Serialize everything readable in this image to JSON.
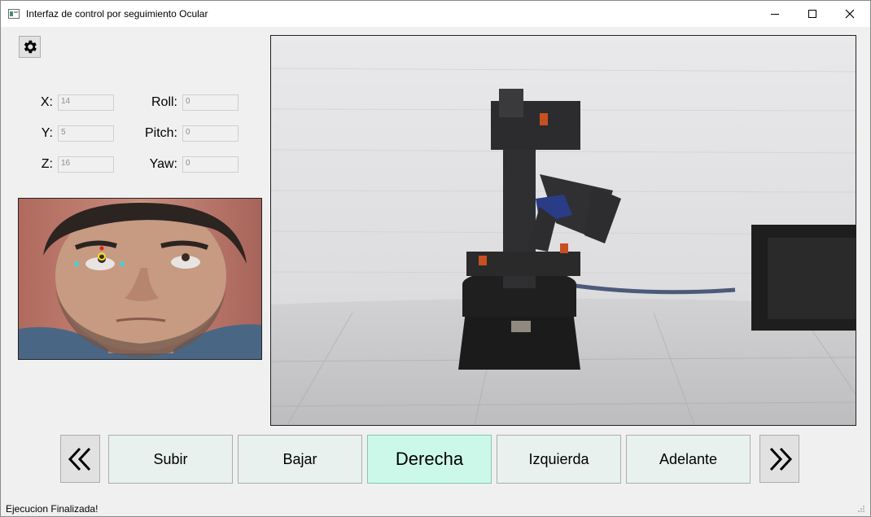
{
  "window": {
    "title": "Interfaz de control por seguimiento Ocular",
    "controls": [
      "minimize-icon",
      "maximize-icon",
      "close-icon"
    ]
  },
  "settings": {
    "icon": "gear-icon"
  },
  "coords": {
    "x_label": "X:",
    "x_value": "14",
    "y_label": "Y:",
    "y_value": "5",
    "z_label": "Z:",
    "z_value": "16",
    "roll_label": "Roll:",
    "roll_value": "0",
    "pitch_label": "Pitch:",
    "pitch_value": "0",
    "yaw_label": "Yaw:",
    "yaw_value": "0"
  },
  "views": {
    "face_feed": "eye-tracking face camera",
    "robot_feed": "robot arm camera"
  },
  "commands": {
    "prev_icon": "double-chevron-left-icon",
    "next_icon": "double-chevron-right-icon",
    "items": [
      "Subir",
      "Bajar",
      "Derecha",
      "Izquierda",
      "Adelante"
    ],
    "active": "Derecha"
  },
  "status": {
    "text": "Ejecucion Finalizada!"
  },
  "colors": {
    "active_button": "#ccf8ea",
    "inactive_button": "#e8f1ee",
    "window_bg": "#f0f0f0"
  }
}
